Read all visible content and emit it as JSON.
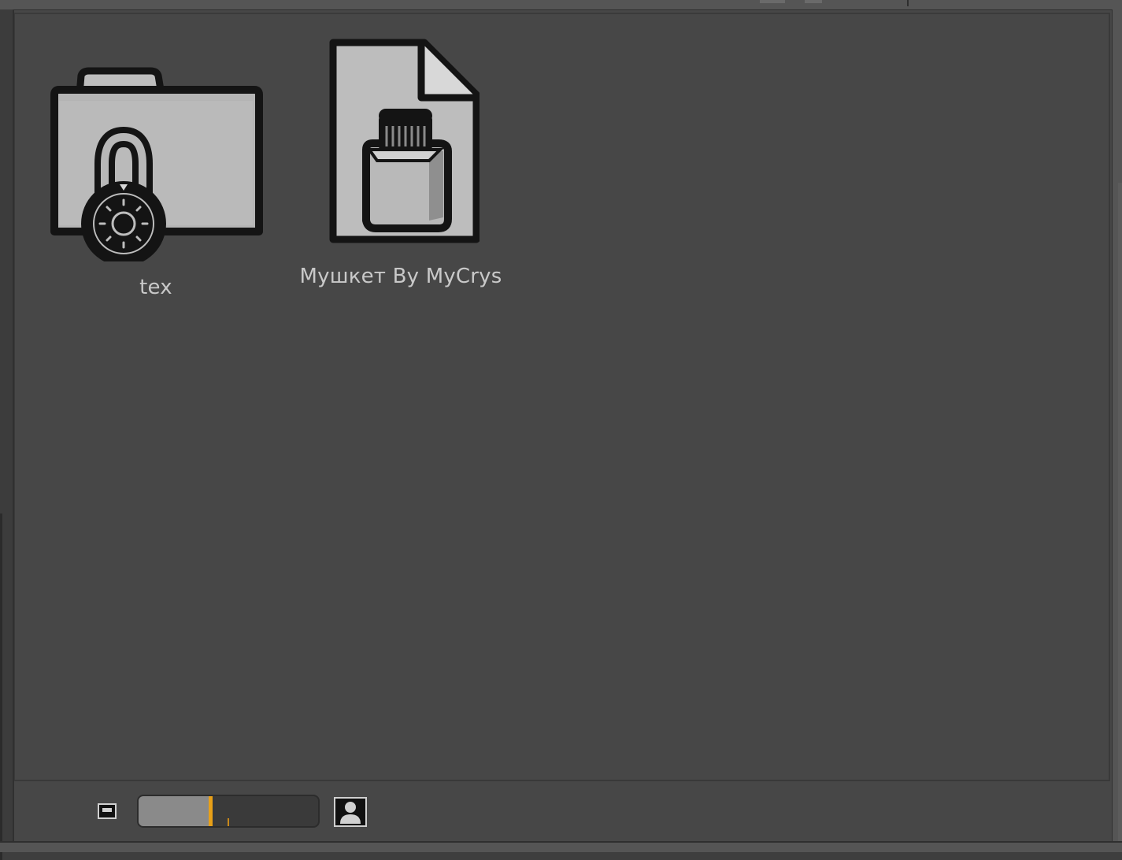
{
  "colors": {
    "background": "#474747",
    "label_text": "#c9c9c9",
    "slider_accent": "#e8a018"
  },
  "assets": [
    {
      "name": "tex",
      "icon": "locked-folder-icon"
    },
    {
      "name": "Мушкет By MyCrys",
      "icon": "material-bottle-file-icon"
    }
  ],
  "thumbnail_size": {
    "value": 0.4,
    "small_icon": "small-thumbnail-icon",
    "large_icon": "large-thumbnail-icon"
  }
}
